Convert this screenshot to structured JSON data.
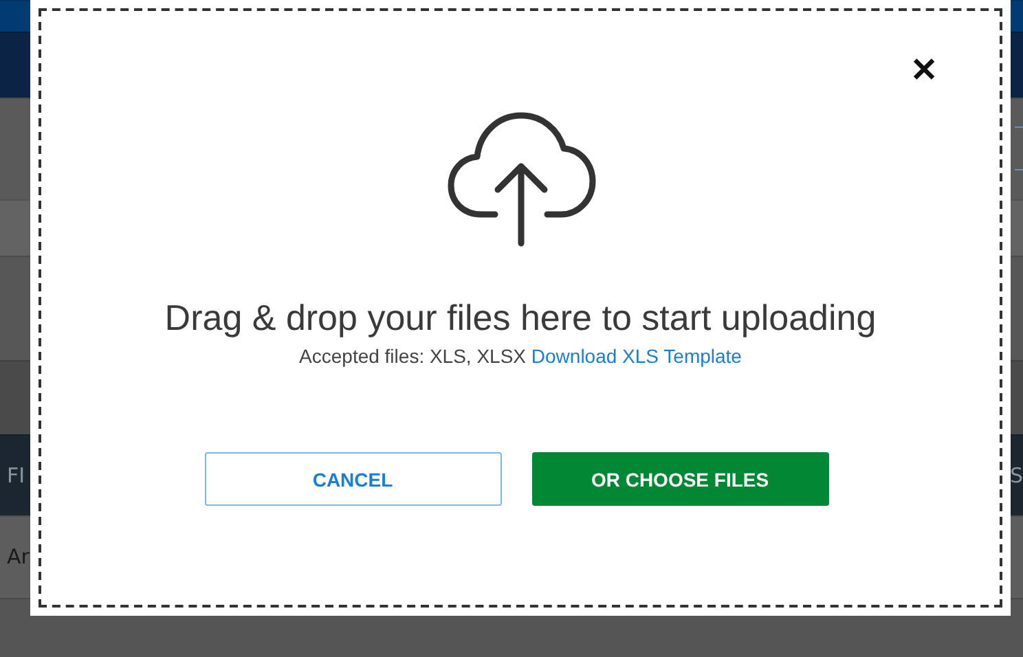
{
  "background": {
    "header_fragment_left": "FI",
    "header_fragment_right": "S",
    "row_fragment": "Ar"
  },
  "dialog": {
    "heading": "Drag & drop your files here to start uploading",
    "accepted": "Accepted files: XLS, XLSX",
    "template_link": "Download XLS Template",
    "close": "✕",
    "buttons": [
      {
        "label": "CANCEL",
        "kind": "secondary"
      },
      {
        "label": "OR CHOOSE FILES",
        "kind": "primary"
      }
    ]
  }
}
